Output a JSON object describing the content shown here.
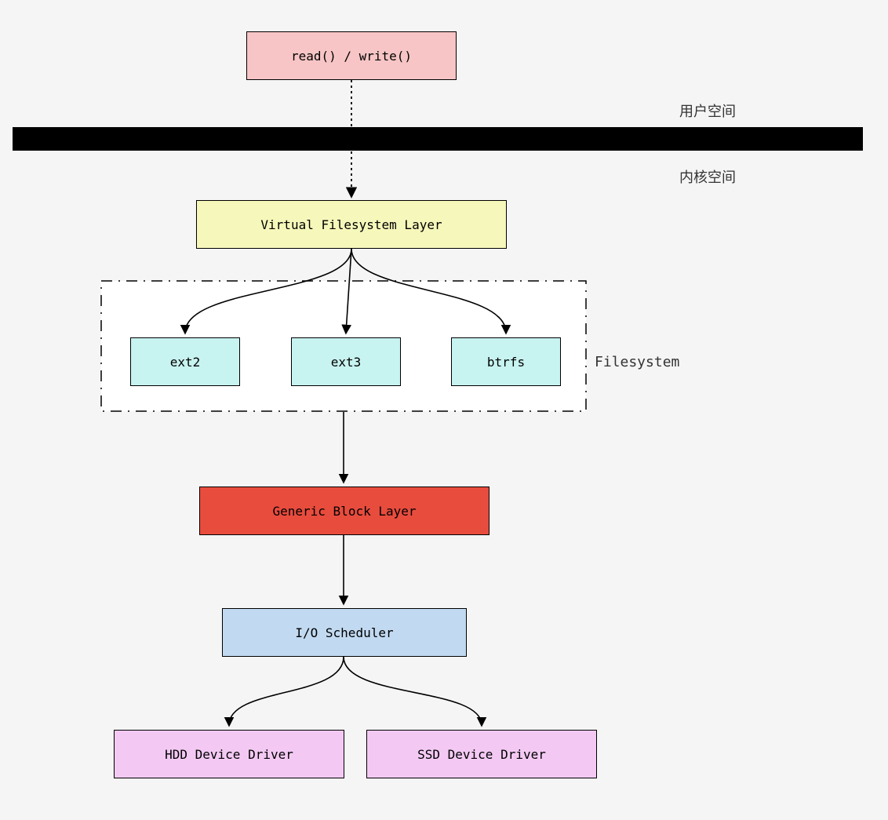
{
  "labels": {
    "user_space": "用户空间",
    "kernel_space": "内核空间",
    "filesystem_group": "Filesystem"
  },
  "boxes": {
    "syscall": "read() / write()",
    "vfs": "Virtual Filesystem Layer",
    "ext2": "ext2",
    "ext3": "ext3",
    "btrfs": "btrfs",
    "block": "Generic Block Layer",
    "iosched": "I/O Scheduler",
    "hdd": "HDD Device Driver",
    "ssd": "SSD Device Driver"
  },
  "colors": {
    "syscall": "#f7c5c5",
    "vfs": "#f6f7ba",
    "fs": "#c7f3f0",
    "block": "#e84c3d",
    "iosched": "#c1daf1",
    "driver": "#f3c9f3"
  }
}
